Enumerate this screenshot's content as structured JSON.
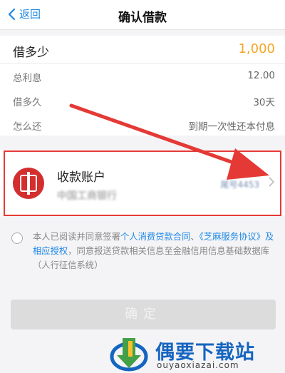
{
  "header": {
    "back_label": "返回",
    "title": "确认借款"
  },
  "amount": {
    "label": "借多少",
    "value": "1,000"
  },
  "details": [
    {
      "label": "总利息",
      "value": "12.00"
    },
    {
      "label": "借多久",
      "value": "30天"
    },
    {
      "label": "怎么还",
      "value": "到期一次性还本付息"
    }
  ],
  "account": {
    "title": "收款账户",
    "bank": "中国工商银行",
    "tail": "尾号4453"
  },
  "agreement": {
    "text1": "本人已阅读并同意签署",
    "link1": "个人消费贷款合同",
    "sep": "、",
    "link2": "《芝麻服务协议》及相应授权",
    "text2": "，同意报送贷款相关信息至金融信用信息基础数据库（人行征信系统）"
  },
  "confirm": {
    "label": "确定"
  },
  "watermark": {
    "name": "偶要下载站",
    "url": "ouyaoxiazai.com"
  },
  "colors": {
    "accent": "#1e88e5",
    "amount": "#f5a623",
    "highlight": "#e53935"
  }
}
